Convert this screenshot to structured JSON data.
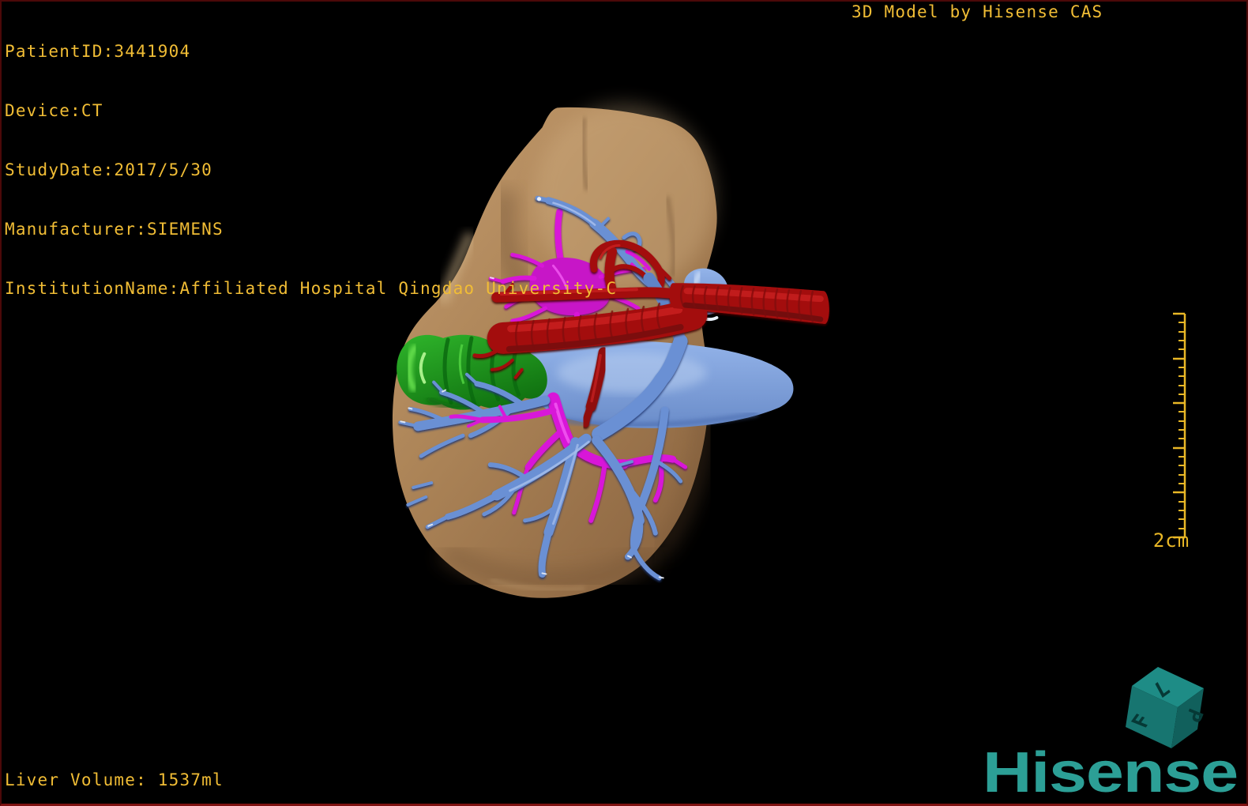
{
  "header": {
    "study_info_lines": [
      "PatientID:3441904",
      "Device:CT",
      "StudyDate:2017/5/30",
      "Manufacturer:SIEMENS",
      "InstitutionName:Affiliated Hospital Qingdao University-C"
    ],
    "watermark": "3D Model by Hisense CAS"
  },
  "footer": {
    "liver_volume": "Liver Volume: 1537ml"
  },
  "scale_bar": {
    "label": "2cm"
  },
  "orientation_cube": {
    "face_left": "F",
    "face_top": "L",
    "face_right": "P"
  },
  "branding": {
    "logo": "Hisense"
  },
  "colors": {
    "overlay_text": "#F1BD35",
    "scale_bar": "#E9B726",
    "logo_teal": "#2C9F96",
    "cube_teal": "#15716C",
    "background": "#000000",
    "border": "#4C0909",
    "liver": "#AD8558",
    "hepatic_vein_blue": "#6B90D4",
    "portal_vein_magenta": "#D818D8",
    "artery_red": "#A30F0F",
    "gallbladder_green": "#2FB52B",
    "vena_cava_light_blue": "#8FAFE6"
  },
  "model_structures": [
    {
      "name": "liver",
      "color": "#AD8558"
    },
    {
      "name": "hepatic-veins",
      "color": "#6B90D4"
    },
    {
      "name": "portal-vein",
      "color": "#D818D8"
    },
    {
      "name": "hepatic-artery-aorta",
      "color": "#A30F0F"
    },
    {
      "name": "gallbladder",
      "color": "#2FB52B"
    },
    {
      "name": "vena-cava",
      "color": "#8FAFE6"
    }
  ]
}
